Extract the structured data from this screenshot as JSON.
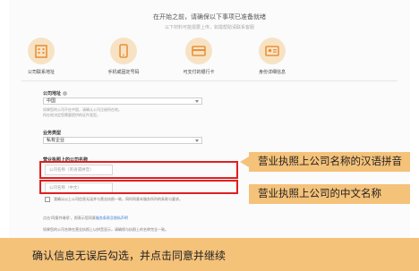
{
  "intro": {
    "title": "在开始之前，请确保以下事项已准备就绪",
    "subtitle": "以下材料可能需要上传，如需帮助请联系客服"
  },
  "requirements": [
    {
      "label": "公司联系地址",
      "icon": "building-icon"
    },
    {
      "label": "手机或固定号码",
      "icon": "phone-icon"
    },
    {
      "label": "可支付的银行卡",
      "icon": "credit-card-icon"
    },
    {
      "label": "身份详细信息",
      "icon": "id-card-icon"
    }
  ],
  "form": {
    "company_location_label": "公司地址",
    "company_location_value": "中国",
    "company_location_hint_1": "如果您的公司不在中国，请确认公司注册所在地。",
    "company_location_hint_2": "所在地决定您需要提供的证件类型。",
    "business_type_label": "业务类型",
    "business_type_value": "私有企业",
    "name_section_label": "营业执照上的公司名称",
    "pinyin_placeholder": "公司名称（英语或拼音）",
    "chinese_placeholder": "公司名称（中文）",
    "confirm_text": "我确认以上公司信息无误并与营业执照一致，同时同意本服务所列的条款与要求。",
    "terms_prefix": "点击\"同意并继续\"，即表示您同意",
    "terms_link": "服务条款及隐私声明",
    "notice_text": "如果您的公司名称在营业执照上以拼音显示，请确保与执照上的名称完全一致。"
  },
  "annotations": {
    "pinyin_callout": "营业执照上公司名称的汉语拼音",
    "chinese_callout": "营业执照上公司的中文名称",
    "bottom_banner": "确认信息无误后勾选，并点击同意并继续"
  },
  "colors": {
    "accent": "#f5c27a",
    "highlight": "#e02020",
    "icon_orange": "#e9913a",
    "link": "#3a7bd5"
  }
}
